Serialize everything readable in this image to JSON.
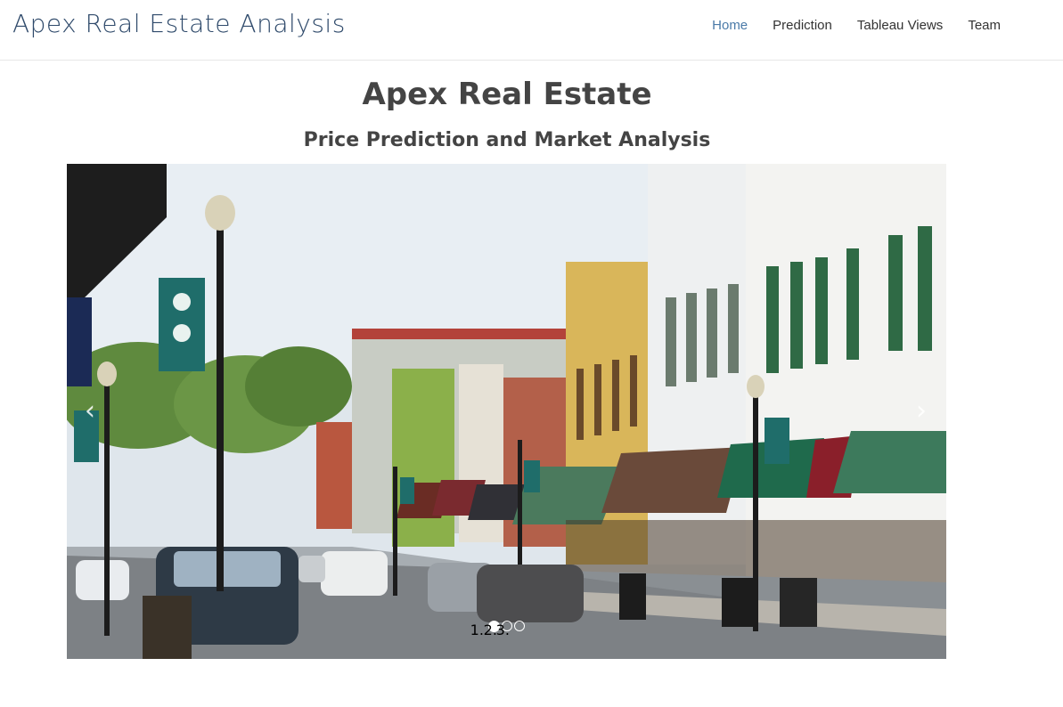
{
  "navbar": {
    "brand": "Apex Real Estate Analysis",
    "items": [
      {
        "label": "Home",
        "active": true
      },
      {
        "label": "Prediction",
        "active": false
      },
      {
        "label": "Tableau Views",
        "active": false
      },
      {
        "label": "Team",
        "active": false
      }
    ]
  },
  "hero": {
    "title": "Apex Real Estate",
    "subtitle": "Price Prediction and Market Analysis"
  },
  "carousel": {
    "prev_icon": "chevron-left-icon",
    "next_icon": "chevron-right-icon",
    "prev_glyph": "‹",
    "next_glyph": "›",
    "slide_count": 3,
    "active_slide": 1,
    "image": "main-street-storefronts-photo"
  },
  "colors": {
    "brand": "#2f4a6b",
    "nav_active": "#4a7aa8",
    "text": "#444444"
  }
}
